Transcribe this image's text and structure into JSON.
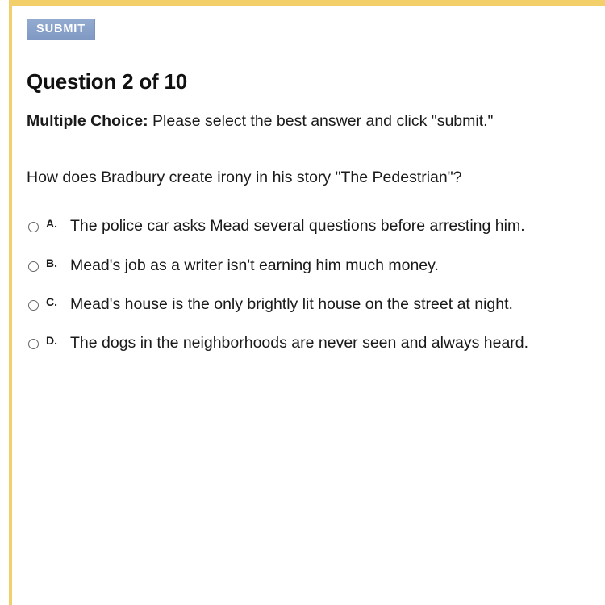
{
  "theme": {
    "accent_gold": "#f2cf69",
    "submit_blue": "#8aa4cb",
    "text_color": "#1a1a1a",
    "rule_gray": "#dcdcdc"
  },
  "toolbar": {
    "submit_label": "SUBMIT"
  },
  "quiz": {
    "heading": "Question 2 of 10",
    "instructions_label": "Multiple Choice:",
    "instructions_text": " Please select the best answer and click \"submit.\"",
    "question": "How does Bradbury create irony in his story \"The Pedestrian\"?",
    "choices": [
      {
        "letter": "A.",
        "text": "The police car asks Mead several questions before arresting him.",
        "selected": false
      },
      {
        "letter": "B.",
        "text": "Mead's job as a writer isn't earning him much money.",
        "selected": false
      },
      {
        "letter": "C.",
        "text": "Mead's house is the only brightly lit house on the street at night.",
        "selected": false
      },
      {
        "letter": "D.",
        "text": "The dogs in the neighborhoods are never seen and always heard.",
        "selected": false
      }
    ]
  }
}
